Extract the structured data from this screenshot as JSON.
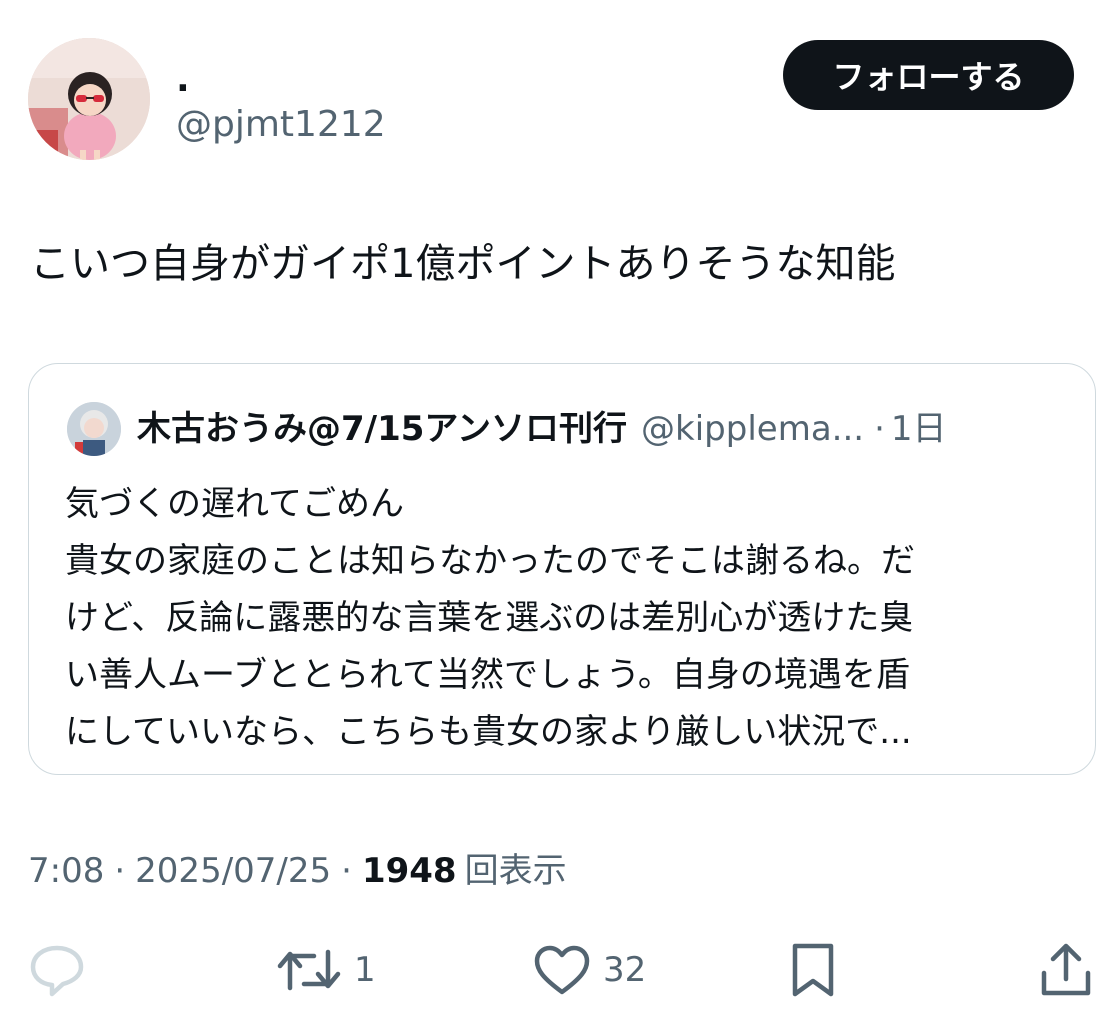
{
  "author": {
    "display_name": ".",
    "handle": "@pjmt1212",
    "follow_label": "フォローする"
  },
  "tweet": {
    "text": "こいつ自身がガイポ1億ポイントありそうな知能"
  },
  "quote": {
    "name": "木古おうみ@7/15アンソロ刊行",
    "handle": "@kipplema...",
    "separator": "·",
    "time": "1日",
    "lines": [
      "気づくの遅れてごめん",
      "貴女の家庭のことは知らなかったのでそこは謝るね。だ",
      "けど、反論に露悪的な言葉を選ぶのは差別心が透けた臭",
      "い善人ムーブととられて当然でしょう。自身の境遇を盾",
      "にしていいなら、こちらも貴女の家より厳しい状況で..."
    ]
  },
  "meta": {
    "time": "7:08",
    "sep1": "·",
    "date": "2025/07/25",
    "sep2": "·",
    "views_count": "1948",
    "views_label": "回表示"
  },
  "actions": {
    "reply_icon": "reply-icon",
    "retweet_icon": "retweet-icon",
    "retweet_count": "1",
    "like_icon": "heart-icon",
    "like_count": "32",
    "bookmark_icon": "bookmark-icon",
    "share_icon": "share-icon"
  },
  "colors": {
    "text": "#0f1419",
    "secondary": "#536471",
    "border": "#cfd9de",
    "button_bg": "#0f1419",
    "reply_icon": "#cfd9de"
  }
}
